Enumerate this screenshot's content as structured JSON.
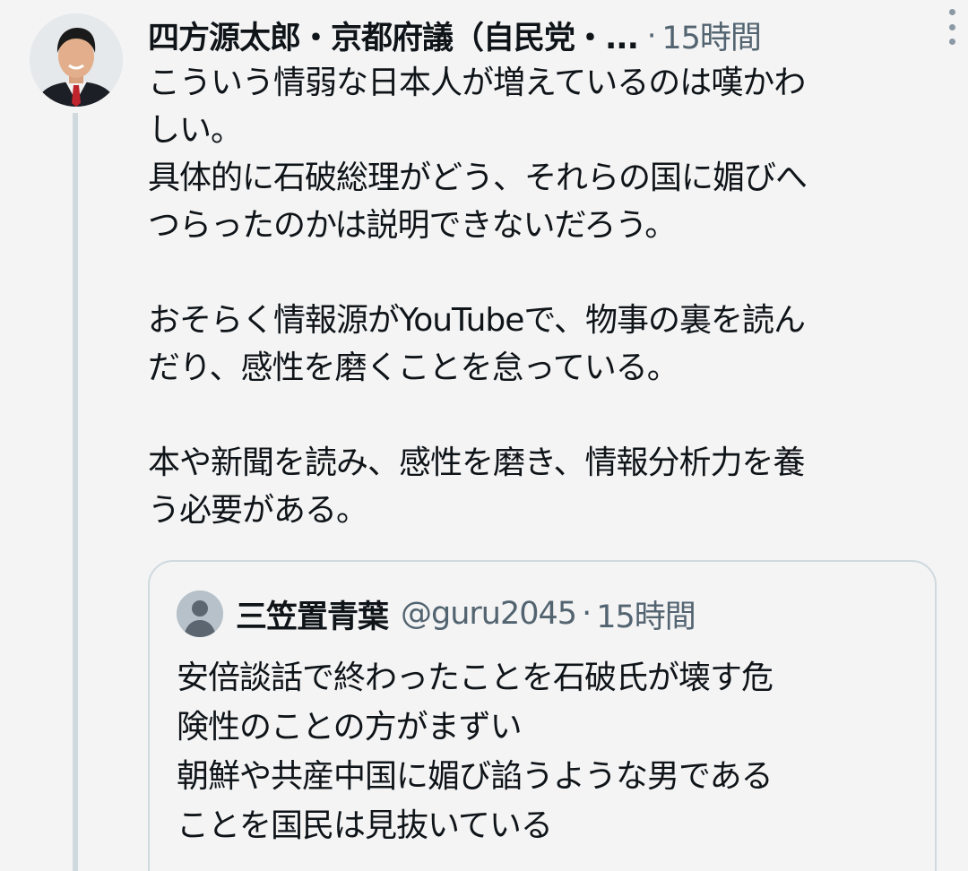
{
  "post": {
    "author_name": "四方源太郎・京都府議（自民党・...",
    "separator": "·",
    "time": "15時間",
    "more_icon": "more-vertical-icon",
    "body_lines": [
      "こういう情弱な日本人が増えているのは嘆かわ",
      "しい。",
      "具体的に石破総理がどう、それらの国に媚びへ",
      "つらったのかは説明できないだろう。",
      "",
      "おそらく情報源がYouTubeで、物事の裏を読ん",
      "だり、感性を磨くことを怠っている。",
      "",
      "本や新聞を読み、感性を磨き、情報分析力を養",
      "う必要がある。"
    ]
  },
  "quote": {
    "avatar_icon": "default-profile-icon",
    "name": "三笠置青葉",
    "handle": "@guru2045",
    "separator": "·",
    "time": "15時間",
    "body_lines": [
      "安倍談話で終わったことを石破氏が壊す危",
      "険性のことの方がまずい",
      "朝鮮や共産中国に媚び諂うような男である",
      "ことを国民は見抜いている"
    ]
  },
  "colors": {
    "background": "#f4f4f4",
    "text": "#0f1419",
    "secondary_text": "#536471",
    "border": "#cfd9de"
  }
}
